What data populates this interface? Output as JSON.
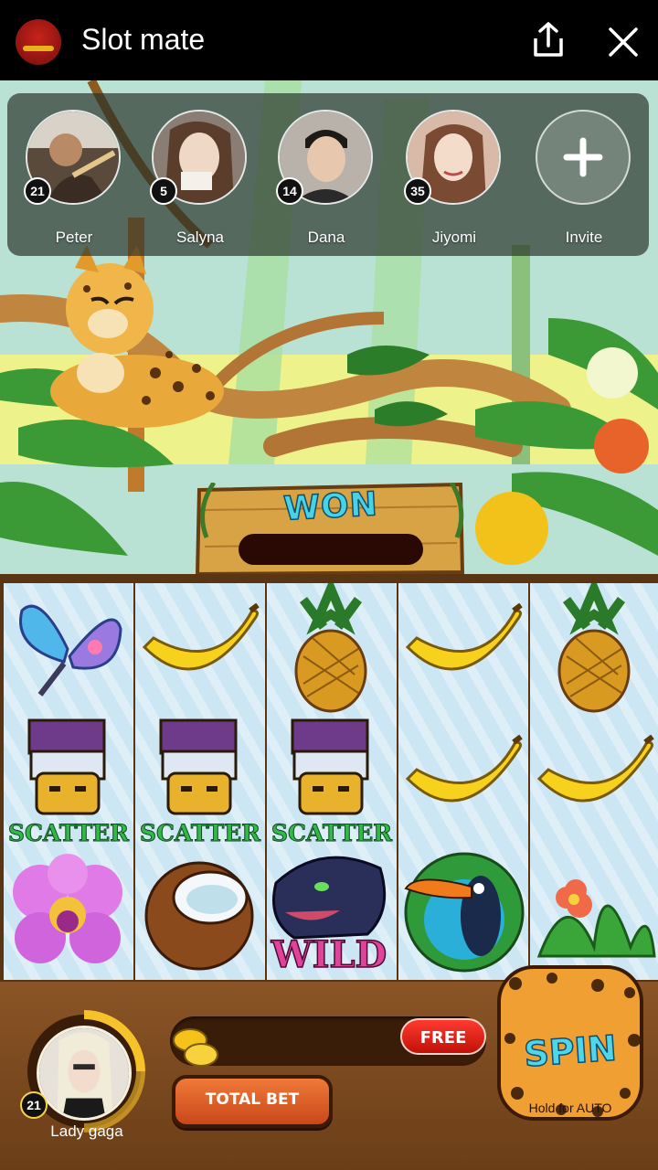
{
  "app": {
    "title": "Slot mate"
  },
  "friends": [
    {
      "name": "Peter",
      "level": "21"
    },
    {
      "name": "Salyna",
      "level": "5"
    },
    {
      "name": "Dana",
      "level": "14"
    },
    {
      "name": "Jiyomi",
      "level": "35"
    }
  ],
  "invite": {
    "label": "Invite"
  },
  "won": {
    "label": "WON"
  },
  "reels": [
    [
      "butterfly",
      "scatter-mask",
      "orchid"
    ],
    [
      "banana",
      "scatter-mask",
      "coconut"
    ],
    [
      "pineapple",
      "scatter-mask",
      "panther-wild"
    ],
    [
      "banana",
      "banana",
      "toucan"
    ],
    [
      "pineapple",
      "banana",
      "jungle-flower"
    ]
  ],
  "symbol_text": {
    "scatter": "SCATTER",
    "wild": "WILD"
  },
  "player": {
    "name": "Lady gaga",
    "level": "21"
  },
  "controls": {
    "free_label": "FREE",
    "total_bet_label": "TOTAL BET",
    "spin_label": "SPIN",
    "spin_sub": "Hold for AUTO"
  },
  "colors": {
    "topbar": "#000000",
    "won_text": "#48d2e6",
    "free_button": "#e0241a",
    "spin_button": "#f0a032"
  }
}
